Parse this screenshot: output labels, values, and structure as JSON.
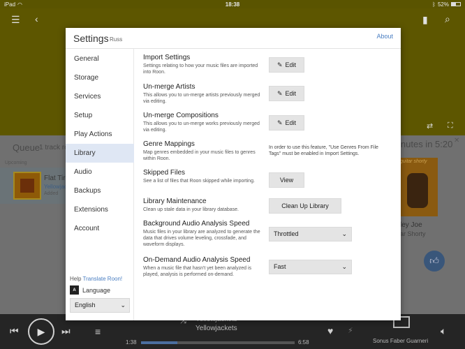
{
  "status": {
    "device": "iPad",
    "time": "18:38",
    "battery": "52%",
    "battery_level": 0.52
  },
  "queue": {
    "title": "Queue",
    "count": "1 track re",
    "upcoming": "Upcoming",
    "track_title": "Flat Tire",
    "track_artist": "Yellowjac",
    "track_added": "Added"
  },
  "right_panel": {
    "time": "inutes in 5:20",
    "album_label": "guitar shorty",
    "title": "ley Joe",
    "artist": "ar Shorty"
  },
  "settings": {
    "title": "Settings",
    "user": "Russ",
    "about": "About",
    "nav": [
      "General",
      "Storage",
      "Services",
      "Setup",
      "Play Actions",
      "Library",
      "Audio",
      "Backups",
      "Extensions",
      "Account"
    ],
    "active_nav": "Library",
    "help_prefix": "Help",
    "help_link": "Translate Roon!",
    "language_label": "Language",
    "language_value": "English",
    "items": [
      {
        "name": "Import Settings",
        "desc": "Settings relating to how your music files are imported into Roon.",
        "action": "Edit"
      },
      {
        "name": "Un-merge Artists",
        "desc": "This allows you to un-merge artists previously merged via editing.",
        "action": "Edit"
      },
      {
        "name": "Un-merge Compositions",
        "desc": "This allows you to un-merge works previously merged via editing.",
        "action": "Edit"
      },
      {
        "name": "Genre Mappings",
        "desc": "Map genres embedded in your music files to genres within Roon.",
        "note": "In order to use this feature, \"Use Genres From File Tags\" must be enabled in Import Settings."
      },
      {
        "name": "Skipped Files",
        "desc": "See a list of files that Roon skipped while importing.",
        "action": "View"
      },
      {
        "name": "Library Maintenance",
        "desc": "Clean up stale data in your library database.",
        "action": "Clean Up Library"
      },
      {
        "name": "Background Audio Analysis Speed",
        "desc": "Music files in your library are analyzed to generate the data that drives volume leveling, crossfade, and waveform displays.",
        "select": "Throttled"
      },
      {
        "name": "On-Demand Audio Analysis Speed",
        "desc": "When a music file that hasn't yet been analyzed is played, analysis is performed on-demand.",
        "select": "Fast"
      }
    ]
  },
  "transport": {
    "now_title": "Yellowjackets",
    "now_artist": "Yellowjackets",
    "elapsed": "1:38",
    "total": "6:58",
    "progress": 0.235,
    "zone": "Sonus Faber Guarneri"
  },
  "colors": {
    "header": "#5d5600",
    "accent": "#4a7ec2",
    "active_nav": "#dfe7f4"
  }
}
